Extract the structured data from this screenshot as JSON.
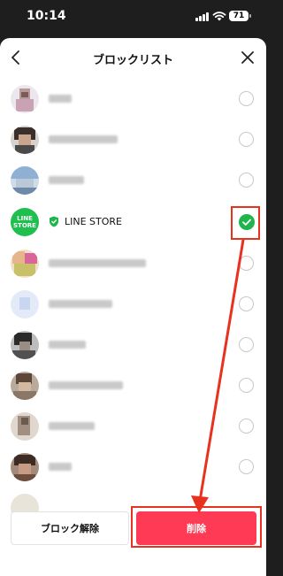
{
  "status_bar": {
    "time": "10:14",
    "battery": "71"
  },
  "header": {
    "title": "ブロックリスト",
    "back_icon": "chevron-left-icon",
    "close_icon": "close-icon"
  },
  "list": {
    "items": [
      {
        "name": "",
        "selected": false,
        "blurred": true
      },
      {
        "name": "",
        "selected": false,
        "blurred": true
      },
      {
        "name": "",
        "selected": false,
        "blurred": true
      },
      {
        "name": "LINE STORE",
        "avatar_text": "LINE\nSTORE",
        "official_badge": true,
        "selected": true,
        "blurred": false
      },
      {
        "name": "",
        "selected": false,
        "blurred": true
      },
      {
        "name": "",
        "selected": false,
        "blurred": true
      },
      {
        "name": "",
        "selected": false,
        "blurred": true
      },
      {
        "name": "",
        "selected": false,
        "blurred": true
      },
      {
        "name": "",
        "selected": false,
        "blurred": true
      },
      {
        "name": "",
        "selected": false,
        "blurred": true
      }
    ]
  },
  "footer": {
    "unblock_label": "ブロック解除",
    "delete_label": "削除"
  },
  "colors": {
    "accent_green": "#20b44d",
    "delete_red": "#ff3a55",
    "annotation_red": "#e8321f"
  }
}
